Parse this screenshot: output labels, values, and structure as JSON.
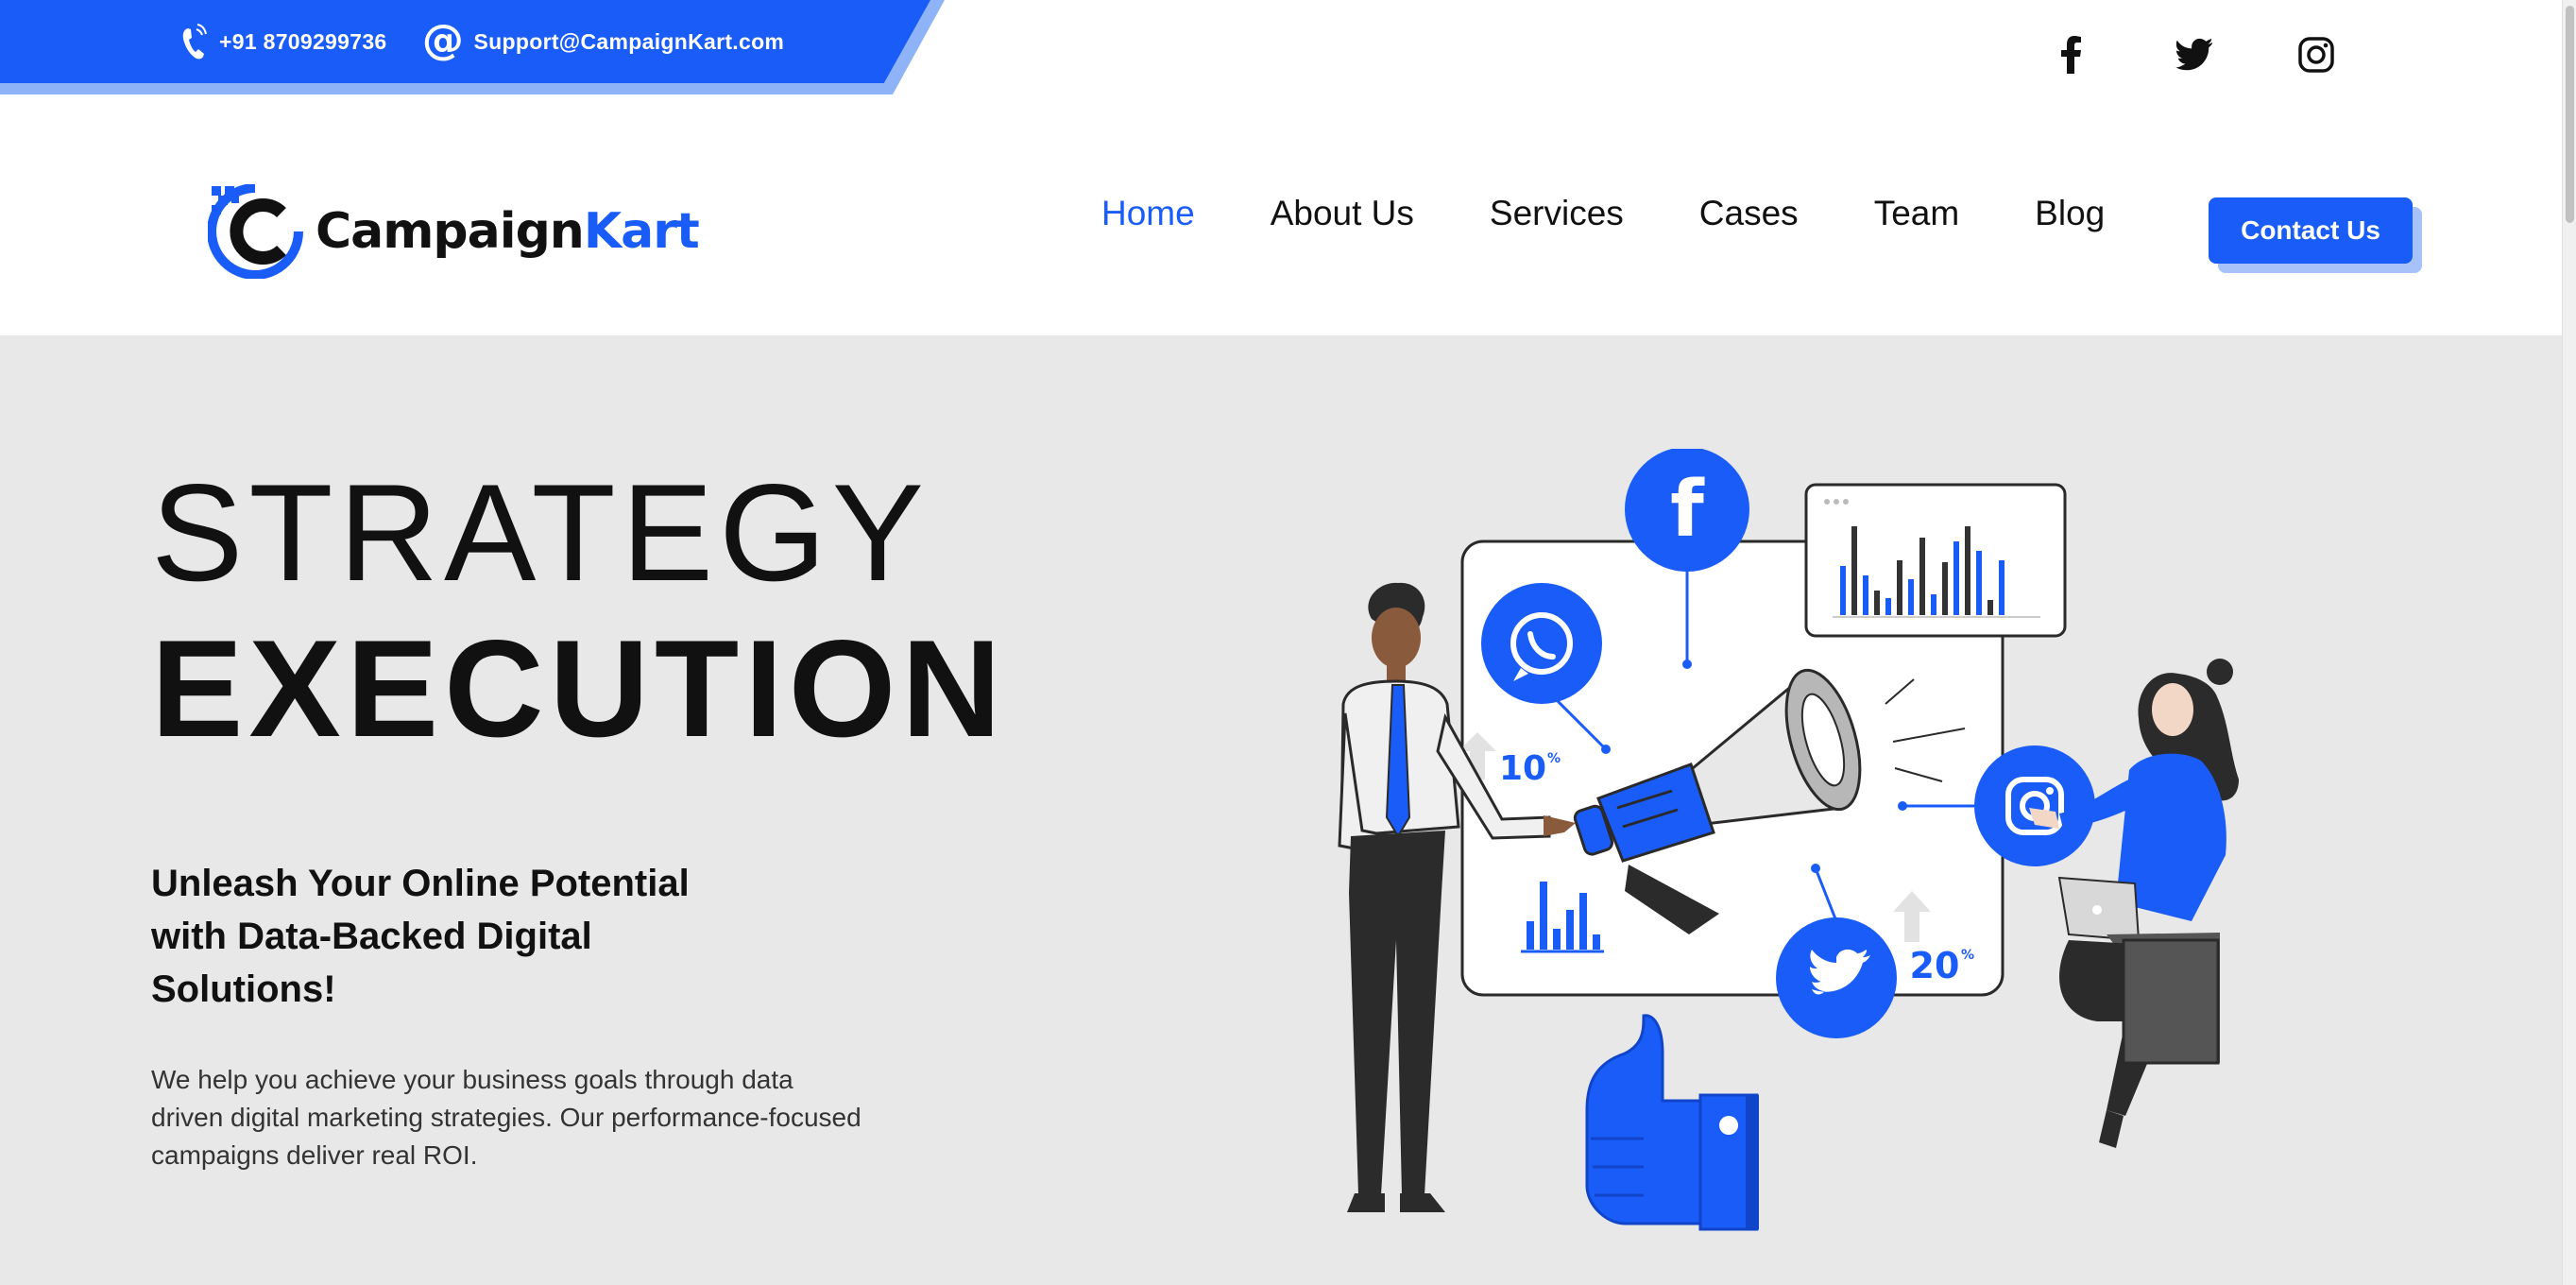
{
  "topbar": {
    "phone": "+91 8709299736",
    "email": "Support@CampaignKart.com",
    "phone_icon": "phone-icon",
    "email_icon": "at-icon",
    "socials": [
      "facebook-icon",
      "twitter-icon",
      "instagram-icon"
    ]
  },
  "brand": {
    "name_part1": "Campaign",
    "name_part2": "Kart",
    "accent": "#1a5cf7"
  },
  "nav": {
    "items": [
      "Home",
      "About Us",
      "Services",
      "Cases",
      "Team",
      "Blog"
    ],
    "active": "Home",
    "cta": "Contact Us"
  },
  "hero": {
    "title_line1": "STRATEGY",
    "title_line2": "EXECUTION",
    "subheading": "Unleash Your Online Potential with Data-Backed Digital Solutions!",
    "description": "We help you achieve your business goals through data driven digital marketing strategies. Our performance-focused campaigns deliver real ROI.",
    "stat1": "10",
    "stat2": "20",
    "percent": "%"
  },
  "colors": {
    "primary": "#1a5cf7",
    "hero_bg": "#e8e8e8",
    "text": "#111111"
  }
}
